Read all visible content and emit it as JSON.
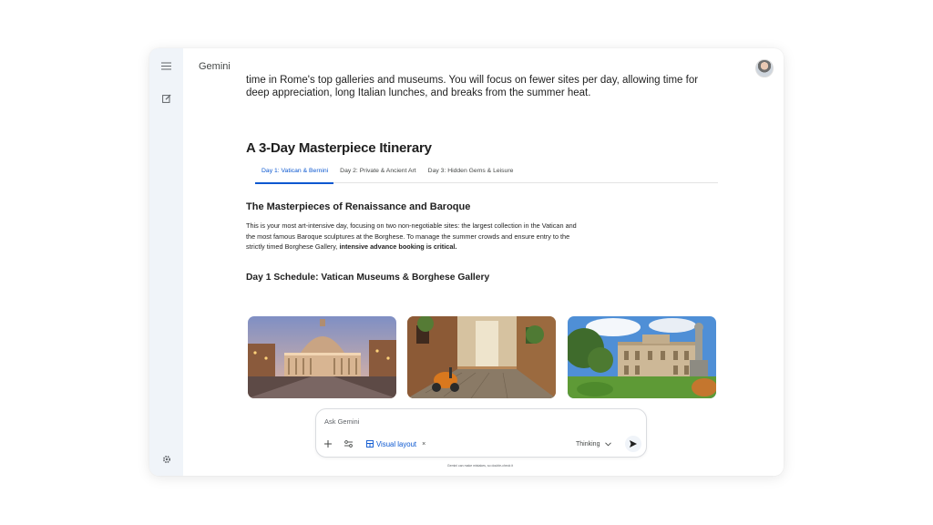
{
  "app": {
    "brand": "Gemini"
  },
  "sidebar": {
    "menu_icon": "menu-icon",
    "new_chat_icon": "edit-icon",
    "settings_icon": "gear-icon"
  },
  "response": {
    "intro": "time in Rome's top galleries and museums. You will focus on fewer sites per day, allowing time for deep appreciation, long Italian lunches, and breaks from the summer heat.",
    "title": "A 3-Day Masterpiece Itinerary",
    "tabs": [
      {
        "label": "Day 1: Vatican & Bernini",
        "active": true
      },
      {
        "label": "Day 2: Private & Ancient Art",
        "active": false
      },
      {
        "label": "Day 3: Hidden Gems & Leisure",
        "active": false
      }
    ],
    "section_title": "The Masterpieces of Renaissance and Baroque",
    "paragraph": "This is your most art-intensive day, focusing on two non-negotiable sites: the largest collection in the Vatican and the most famous Baroque sculptures at the Borghese. To manage the summer crowds and ensure entry to the strictly timed Borghese Gallery, ",
    "paragraph_bold": "intensive advance booking is critical.",
    "schedule_title": "Day 1 Schedule: Vatican Museums & Borghese Gallery",
    "images": [
      "st-peters-basilica-photo",
      "rome-alley-scooter-photo",
      "villa-borghese-photo"
    ]
  },
  "composer": {
    "placeholder": "Ask Gemini",
    "tool_chip": "Visual layout",
    "chip_close": "×",
    "mode": "Thinking",
    "disclaimer": "Gemini can make mistakes, so double-check it"
  },
  "colors": {
    "accent": "#0b57d0",
    "rail": "#f0f4f9"
  }
}
